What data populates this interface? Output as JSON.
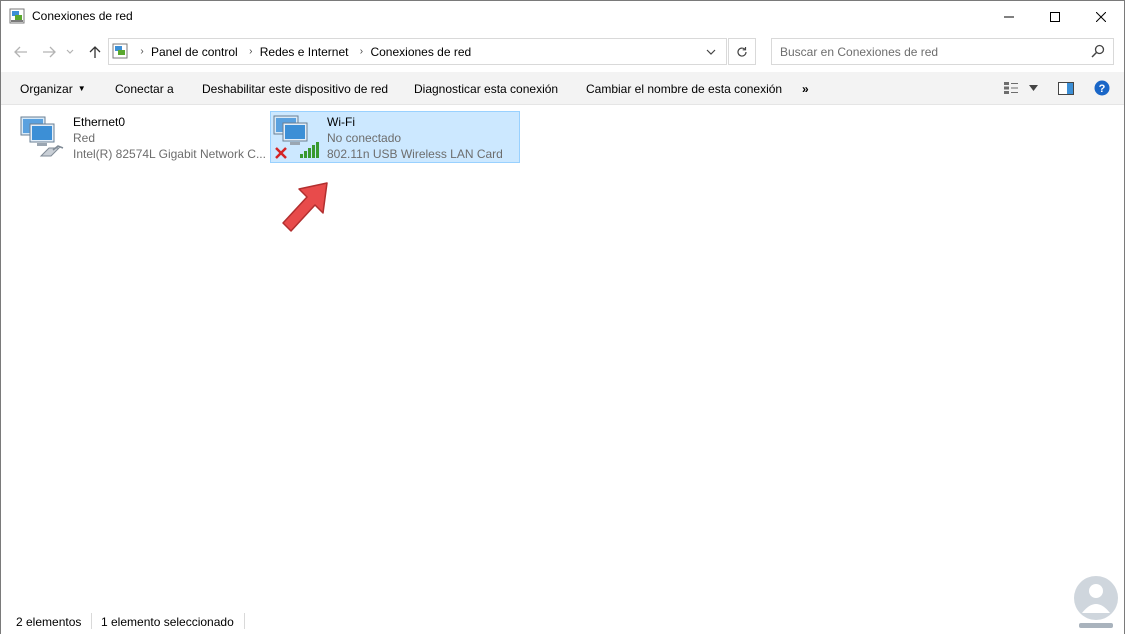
{
  "window": {
    "title": "Conexiones de red",
    "icon": "network-connections-icon"
  },
  "nav": {
    "breadcrumbs": [
      "Panel de control",
      "Redes e Internet",
      "Conexiones de red"
    ],
    "search_placeholder": "Buscar en Conexiones de red"
  },
  "commands": {
    "organize": "Organizar",
    "connect": "Conectar a",
    "disable": "Deshabilitar este dispositivo de red",
    "diagnose": "Diagnosticar esta conexión",
    "rename": "Cambiar el nombre de esta conexión",
    "more": "»"
  },
  "connections": [
    {
      "name": "Ethernet0",
      "status": "Red",
      "adapter": "Intel(R) 82574L Gigabit Network C...",
      "icon": "ethernet-adapter-icon",
      "selected": false
    },
    {
      "name": "Wi-Fi",
      "status": "No conectado",
      "adapter": "802.11n USB Wireless LAN Card",
      "icon": "wifi-adapter-icon",
      "selected": true
    }
  ],
  "status": {
    "count": "2 elementos",
    "selection": "1 elemento seleccionado"
  },
  "colors": {
    "selection_bg": "#cce8ff",
    "selection_border": "#99d1ff",
    "arrow": "#e84b4b",
    "help": "#1a66c7"
  }
}
